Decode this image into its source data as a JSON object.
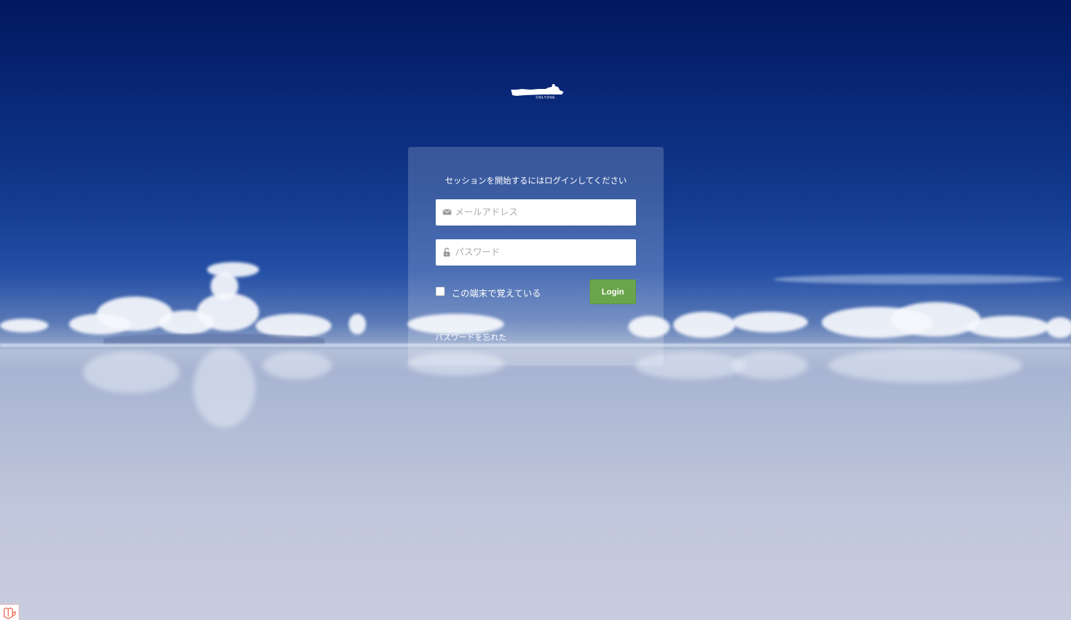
{
  "brand": {
    "logo_text": "ONLYONE"
  },
  "login": {
    "message": "セッションを開始するにはログインしてください",
    "email_placeholder": "メールアドレス",
    "password_placeholder": "パスワード",
    "remember_label": "この端末で覚えている",
    "login_button": "Login",
    "forgot_link": "パスワードを忘れた"
  },
  "colors": {
    "login_button": "#6aa54b",
    "sky": "#01185f",
    "salt_flat": "#c0c6dc"
  },
  "icons": {
    "email": "envelope-icon",
    "password": "unlock-icon",
    "debugbar": "laravel-icon"
  }
}
